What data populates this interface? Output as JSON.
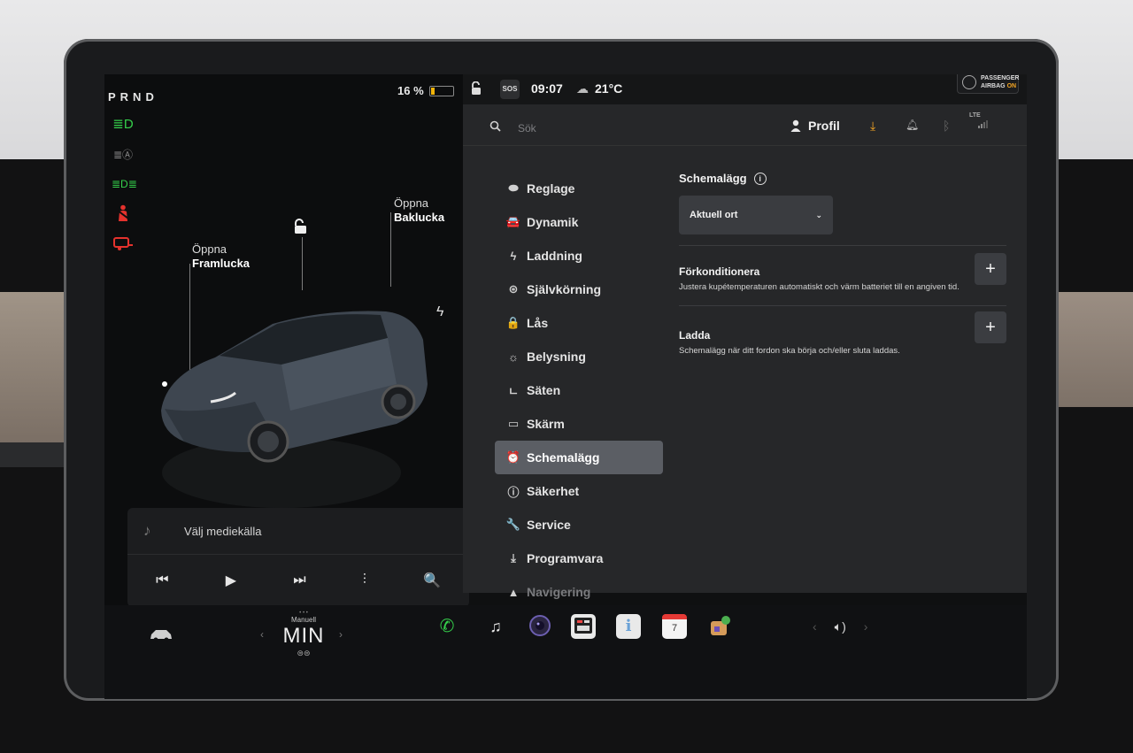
{
  "left_panel": {
    "gear": "PRND",
    "battery_percent": "16 %",
    "battery_level": 0.16,
    "front_trunk": {
      "line1": "Öppna",
      "line2": "Framlucka"
    },
    "rear_trunk": {
      "line1": "Öppna",
      "line2": "Baklucka"
    },
    "media_source": "Välj mediekälla",
    "media_controls": {
      "prev": "⏮",
      "play": "▶",
      "next": "⏭",
      "eq": "⫶",
      "search": "🔍"
    }
  },
  "status_bar": {
    "time": "09:07",
    "temperature": "21°C",
    "sos": "SOS",
    "airbag_line1": "PASSENGER",
    "airbag_line2": "AIRBAG",
    "airbag_state": "ON"
  },
  "header": {
    "search_placeholder": "Sök",
    "profile_label": "Profil",
    "signal": "LTE"
  },
  "menu": {
    "items": [
      {
        "label": "Reglage",
        "icon": "toggle-icon",
        "glyph": "⬬"
      },
      {
        "label": "Dynamik",
        "icon": "car-icon",
        "glyph": "🚘"
      },
      {
        "label": "Laddning",
        "icon": "bolt-icon",
        "glyph": "ϟ"
      },
      {
        "label": "Självkörning",
        "icon": "steering-wheel-icon",
        "glyph": "⊛"
      },
      {
        "label": "Lås",
        "icon": "lock-icon",
        "glyph": "🔒"
      },
      {
        "label": "Belysning",
        "icon": "sun-icon",
        "glyph": "☼"
      },
      {
        "label": "Säten",
        "icon": "seat-icon",
        "glyph": "ㄴ"
      },
      {
        "label": "Skärm",
        "icon": "display-icon",
        "glyph": "▭"
      },
      {
        "label": "Schemalägg",
        "icon": "alarm-clock-icon",
        "glyph": "⏰"
      },
      {
        "label": "Säkerhet",
        "icon": "alert-icon",
        "glyph": "ⓘ"
      },
      {
        "label": "Service",
        "icon": "wrench-icon",
        "glyph": "🔧"
      },
      {
        "label": "Programvara",
        "icon": "download-icon",
        "glyph": "⤓"
      },
      {
        "label": "Navigering",
        "icon": "navigation-icon",
        "glyph": "▲"
      }
    ],
    "active_index": 8
  },
  "content": {
    "section_title": "Schemalägg",
    "location_dropdown": "Aktuell ort",
    "rows": [
      {
        "title": "Förkonditionera",
        "description": "Justera kupétemperaturen automatiskt och värm batteriet till en angiven tid.",
        "button": "+"
      },
      {
        "title": "Ladda",
        "description": "Schemalägg när ditt fordon ska börja och/eller sluta laddas.",
        "button": "+"
      }
    ]
  },
  "bottom_bar": {
    "climate_mode": "Manuell",
    "climate_value": "MIN",
    "calendar_day": "7"
  },
  "colors": {
    "accent_orange": "#f5a623",
    "battery_yellow": "#f1b40a",
    "green_light": "#35d04b",
    "red_warning": "#e5322d",
    "active_menu": "#5b5e64"
  }
}
